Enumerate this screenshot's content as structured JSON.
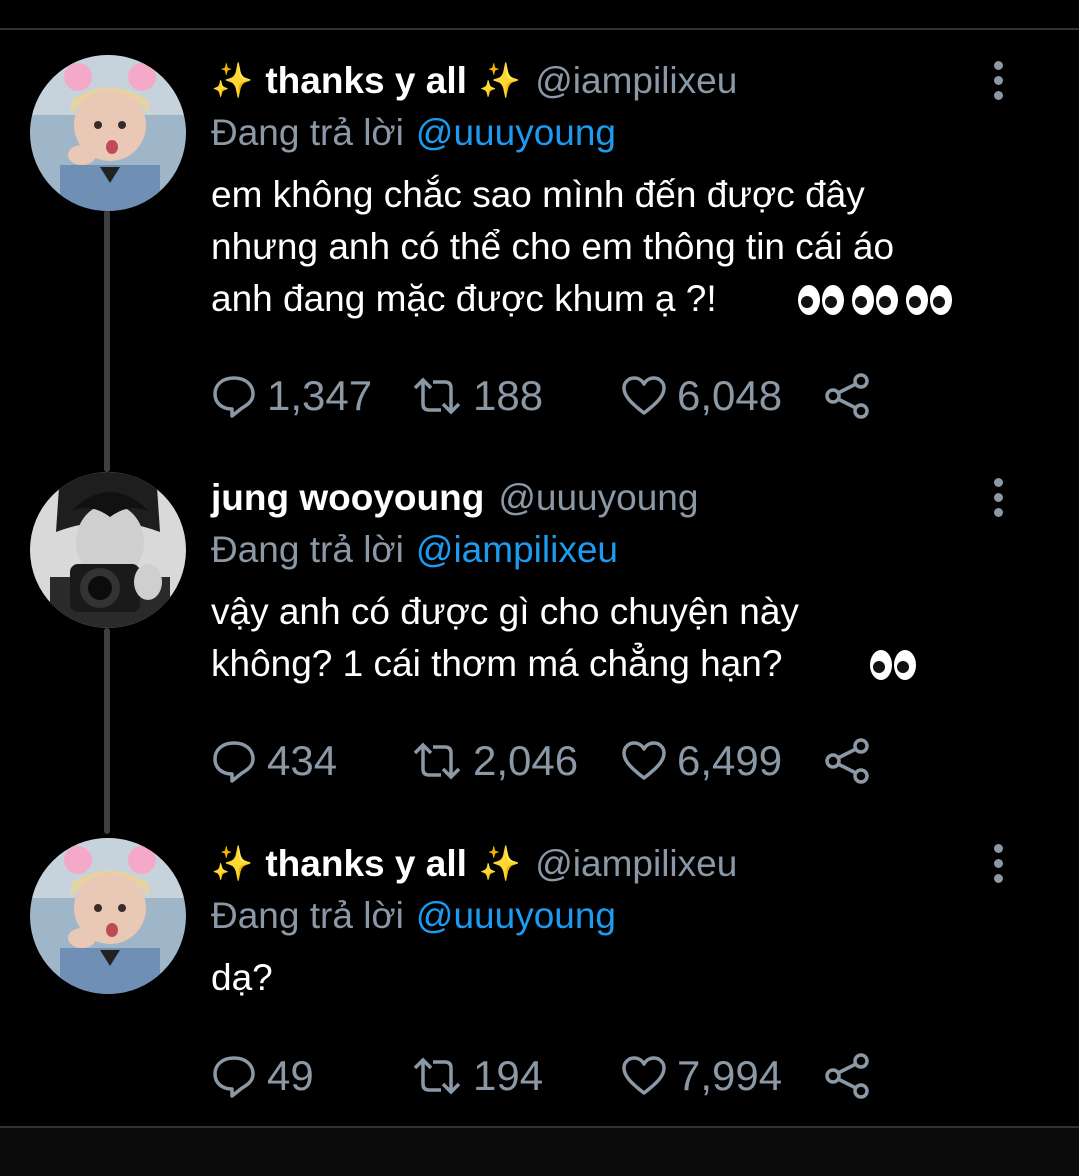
{
  "tweets": [
    {
      "display_name": "thanks y all",
      "handle": "@iampilixeu",
      "replying_prefix": "Đang trả lời",
      "replying_to": "@uuuyoung",
      "text": "em không chắc sao mình đến được đây\nnhưng anh có thể cho em thông tin cái áo\nanh đang mặc được khum ạ ?!",
      "eye_emoji_count": 3,
      "replies": "1,347",
      "retweets": "188",
      "likes": "6,048"
    },
    {
      "display_name": "jung wooyoung",
      "handle": "@uuuyoung",
      "replying_prefix": "Đang trả lời",
      "replying_to": "@iampilixeu",
      "text": "vậy anh có được gì cho chuyện này\nkhông? 1 cái thơm má chẳng hạn?",
      "eye_emoji_count": 1,
      "replies": "434",
      "retweets": "2,046",
      "likes": "6,499"
    },
    {
      "display_name": "thanks y all",
      "handle": "@iampilixeu",
      "replying_prefix": "Đang trả lời",
      "replying_to": "@uuuyoung",
      "text": "dạ?",
      "eye_emoji_count": 0,
      "replies": "49",
      "retweets": "194",
      "likes": "7,994"
    }
  ],
  "icons": {
    "reply": "reply-icon",
    "retweet": "retweet-icon",
    "like": "heart-icon",
    "share": "share-icon",
    "more": "more-vertical-icon",
    "sparkles": "sparkles-emoji",
    "eyes": "eyes-emoji"
  },
  "colors": {
    "background": "#000000",
    "text": "#ffffff",
    "muted": "#8b98a5",
    "mention": "#1d9bf0",
    "divider": "#2f3336"
  }
}
